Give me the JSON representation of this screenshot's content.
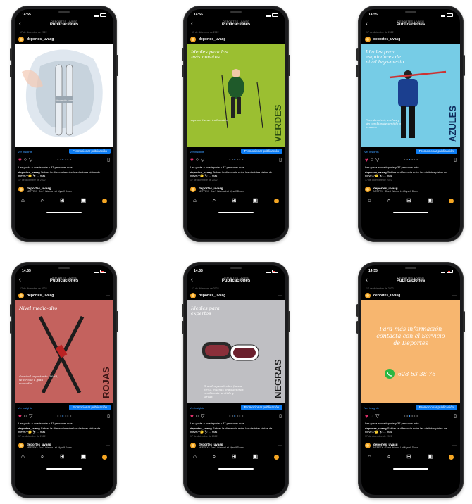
{
  "status": {
    "time": "14:55"
  },
  "header": {
    "username": "DEPORTES_UVASG",
    "title": "Publicaciones"
  },
  "account": {
    "name": "deportes_uvasg"
  },
  "insights_label": "Ver insights",
  "promote_label": "Promocionar publicación",
  "likes_text": "Les gusta a uvadeporte y 37 personas más",
  "caption": {
    "user": "deportes_uvasg",
    "text": "Sabías la diferencia entre las distintas pistas de nieve??🤔 ⛷ ... más"
  },
  "post_date": "17 de diciembre de 2022",
  "music": {
    "name": "deportes_uvasg",
    "song": "NEFFEX · Don't Wanna Let Myself Down"
  },
  "icons": [
    "back-icon",
    "more-icon",
    "heart-icon",
    "comment-icon",
    "share-icon",
    "bookmark-icon",
    "home-icon",
    "search-icon",
    "add-icon",
    "reels-icon",
    "profile-icon"
  ],
  "colors": {
    "green": "#9bbf31",
    "blue": "#76cce6",
    "red": "#c4625e",
    "grey": "#bfbfc3",
    "orange": "#f7b66f",
    "promo": "#0d7cf2"
  },
  "posts": [
    {
      "id": "white",
      "bg": "#ffffff",
      "watermark": "Nevando.com"
    },
    {
      "id": "verdes",
      "bg": "#9bbf31",
      "heading": "Ideales para los más novatos.",
      "side": "VERDES",
      "note": "Apenas tienen inclinación"
    },
    {
      "id": "azules",
      "bg": "#76cce6",
      "heading": "Ideales para esquiadores de nivel bajo-medio",
      "side": "AZULES",
      "note": "Poco desnivel, anchas y sin cambios de sentido o bruscos"
    },
    {
      "id": "rojas",
      "bg": "#c4625e",
      "heading": "Nivel medio-alto",
      "side": "ROJAS",
      "note": "desnivel importante (40%), se circula a gran velocidad"
    },
    {
      "id": "negras",
      "bg": "#bfbfc3",
      "heading": "Ideales para expertos",
      "side": "NEGRAS",
      "note": "Grandes pendientes (hasta 50%), muchas ondulaciones, cambios de sentido y largas"
    },
    {
      "id": "info",
      "bg": "#f7b66f",
      "heading": "Para más información contacta con el Servicio de Deportes",
      "phone": "628 63 38 76"
    }
  ]
}
